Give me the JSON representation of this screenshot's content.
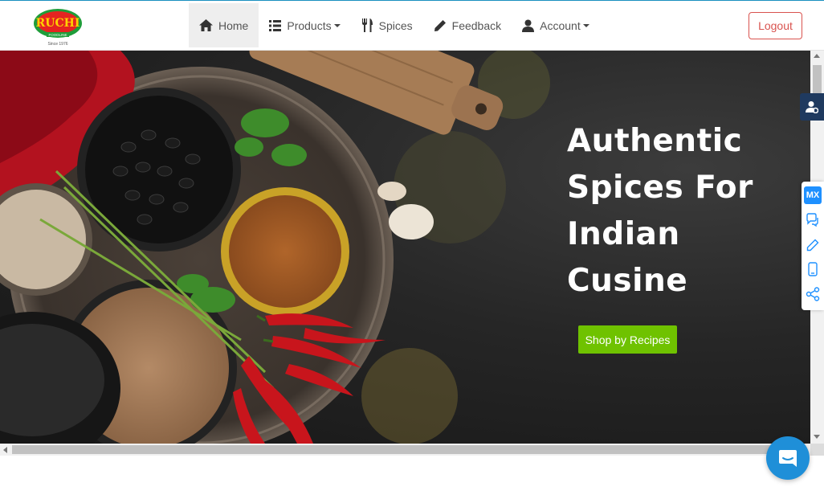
{
  "brand": {
    "logo_text": "RUCHI",
    "logo_subtext": "FOODLINE",
    "logo_since": "Since 1976"
  },
  "nav": {
    "items": [
      {
        "label": "Home",
        "icon": "home-icon",
        "dropdown": false,
        "active": true
      },
      {
        "label": "Products",
        "icon": "list-icon",
        "dropdown": true,
        "active": false
      },
      {
        "label": "Spices",
        "icon": "cutlery-icon",
        "dropdown": false,
        "active": false
      },
      {
        "label": "Feedback",
        "icon": "pencil-icon",
        "dropdown": false,
        "active": false
      },
      {
        "label": "Account",
        "icon": "user-icon",
        "dropdown": true,
        "active": false
      }
    ],
    "logout_label": "Logout"
  },
  "hero": {
    "headline_lines": [
      "Authentic",
      "Spices For",
      "Indian",
      "Cusine"
    ],
    "cta_label": "Shop by Recipes"
  },
  "side_toolbar": {
    "badge": "MX",
    "icons": [
      "chat-icon",
      "edit-icon",
      "mobile-icon",
      "share-icon"
    ]
  },
  "colors": {
    "nav_border_top": "#1a8fbf",
    "logout": "#d9534f",
    "cta": "#6fc200",
    "chat": "#1f8fd8",
    "user_widget": "#1f3a5f"
  }
}
